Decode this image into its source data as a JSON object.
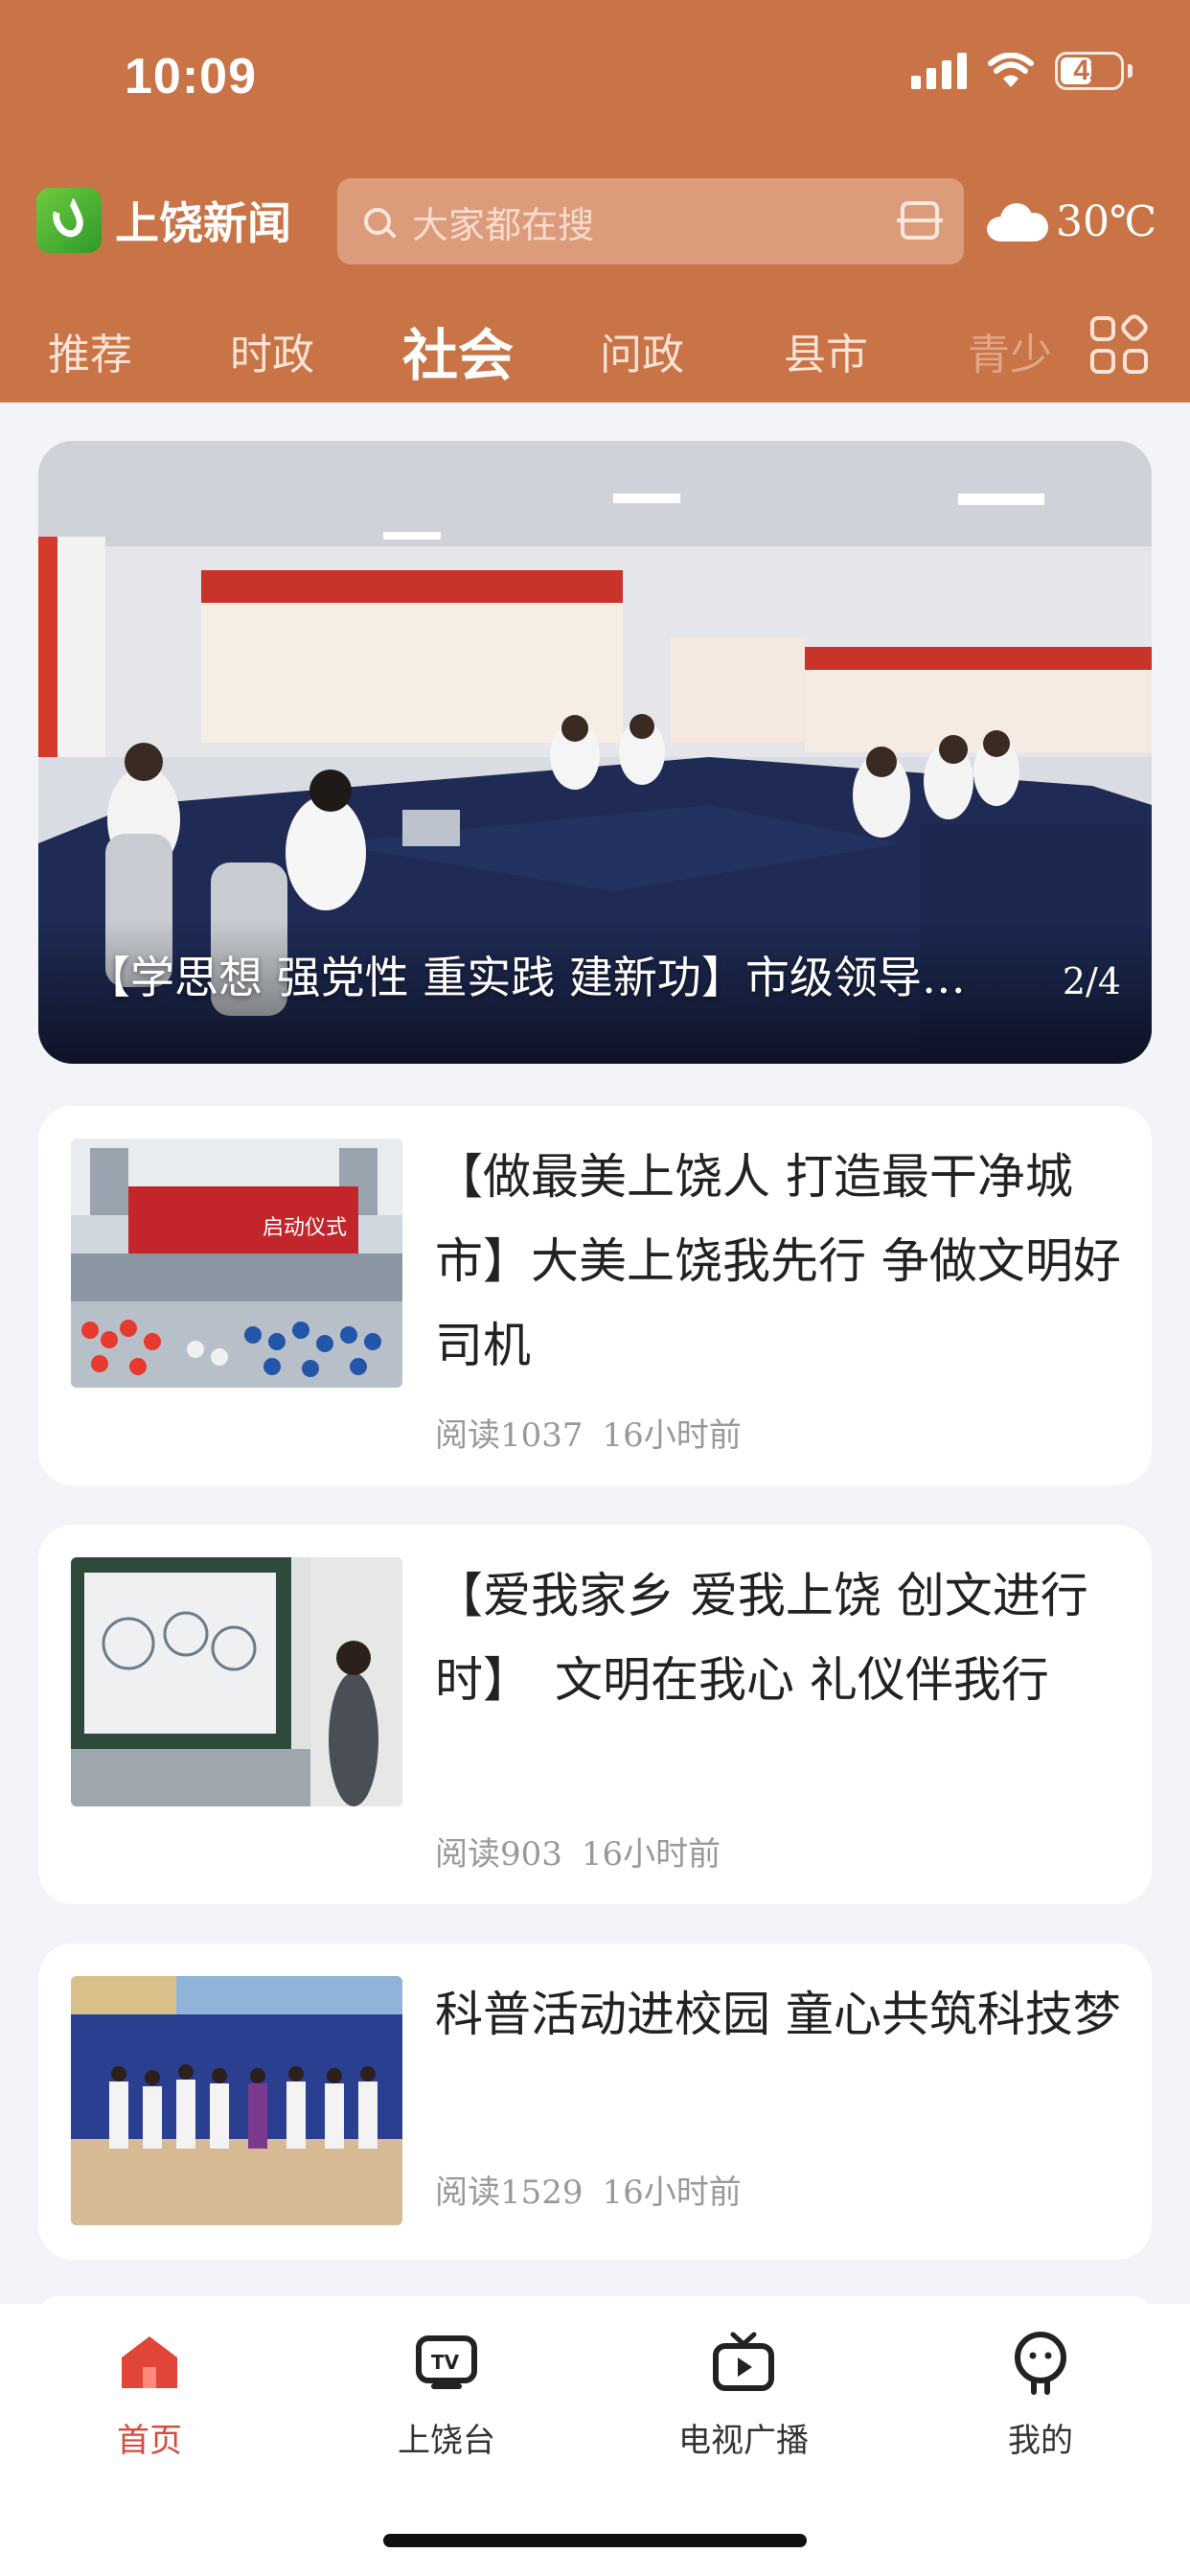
{
  "status_bar": {
    "time": "10:09",
    "battery": "42"
  },
  "header": {
    "app_name": "上饶新闻",
    "search_placeholder": "大家都在搜",
    "weather": "30℃"
  },
  "tabs": [
    {
      "label": "推荐"
    },
    {
      "label": "时政"
    },
    {
      "label": "社会",
      "active": true
    },
    {
      "label": "问政"
    },
    {
      "label": "县市"
    },
    {
      "label": "青少"
    }
  ],
  "hero": {
    "caption": "【学思想 强党性 重实践 建新功】市级领导…",
    "page_indicator": "2/4"
  },
  "articles": [
    {
      "title": "【做最美上饶人 打造最干净城市】大美上饶我先行 争做文明好司机",
      "reads": "阅读1037",
      "time": "16小时前",
      "thumb_text": "启动仪式"
    },
    {
      "title": "【爱我家乡 爱我上饶 创文进行时】　文明在我心 礼仪伴我行",
      "reads": "阅读903",
      "time": "16小时前"
    },
    {
      "title": "科普活动进校园 童心共筑科技梦",
      "reads": "阅读1529",
      "time": "16小时前"
    }
  ],
  "bottom_nav": [
    {
      "label": "首页",
      "icon": "home-icon",
      "active": true
    },
    {
      "label": "上饶台",
      "icon": "tv-icon"
    },
    {
      "label": "电视广播",
      "icon": "broadcast-icon"
    },
    {
      "label": "我的",
      "icon": "profile-icon"
    }
  ],
  "colors": {
    "brand": "#c97447",
    "active_nav": "#d9493a"
  }
}
